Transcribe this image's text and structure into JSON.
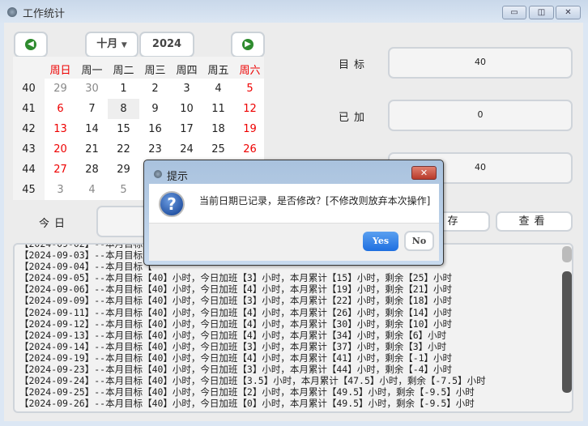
{
  "window": {
    "title": "工作统计",
    "minimize": "▭",
    "restore": "◫",
    "close": "✕"
  },
  "calendar": {
    "month": "十月",
    "year": "2024",
    "prev": "◀",
    "next": "▶",
    "weekdays": [
      "周日",
      "周一",
      "周二",
      "周三",
      "周四",
      "周五",
      "周六"
    ],
    "weeks": [
      "40",
      "41",
      "42",
      "43",
      "44",
      "45"
    ],
    "days": [
      [
        "29",
        "30",
        "1",
        "2",
        "3",
        "4",
        "5"
      ],
      [
        "6",
        "7",
        "8",
        "9",
        "10",
        "11",
        "12"
      ],
      [
        "13",
        "14",
        "15",
        "16",
        "17",
        "18",
        "19"
      ],
      [
        "20",
        "21",
        "22",
        "23",
        "24",
        "25",
        "26"
      ],
      [
        "27",
        "28",
        "29",
        "30",
        "31",
        "1",
        "2"
      ],
      [
        "3",
        "4",
        "5",
        "6",
        "7",
        "8",
        "9"
      ]
    ],
    "selected": "8"
  },
  "form": {
    "target_label": "目标",
    "target_value": "40",
    "added_label": "已加",
    "added_value": "0",
    "third_value": "40",
    "today_label": "今日",
    "save": "保存",
    "view": "查看"
  },
  "log": [
    "【2024-09-03】--本月目标【",
    "【2024-09-04】--本月目标【",
    "【2024-09-05】--本月目标【40】小时，今日加班【3】小时，本月累计【15】小时，剩余【25】小时",
    "【2024-09-06】--本月目标【40】小时，今日加班【4】小时，本月累计【19】小时，剩余【21】小时",
    "【2024-09-09】--本月目标【40】小时，今日加班【3】小时，本月累计【22】小时，剩余【18】小时",
    "【2024-09-11】--本月目标【40】小时，今日加班【4】小时，本月累计【26】小时，剩余【14】小时",
    "【2024-09-12】--本月目标【40】小时，今日加班【4】小时，本月累计【30】小时，剩余【10】小时",
    "【2024-09-13】--本月目标【40】小时，今日加班【4】小时，本月累计【34】小时，剩余【6】小时",
    "【2024-09-14】--本月目标【40】小时，今日加班【3】小时，本月累计【37】小时，剩余【3】小时",
    "【2024-09-19】--本月目标【40】小时，今日加班【4】小时，本月累计【41】小时，剩余【-1】小时",
    "【2024-09-23】--本月目标【40】小时，今日加班【3】小时，本月累计【44】小时，剩余【-4】小时",
    "【2024-09-24】--本月目标【40】小时，今日加班【3.5】小时，本月累计【47.5】小时，剩余【-7.5】小时",
    "【2024-09-25】--本月目标【40】小时，今日加班【2】小时，本月累计【49.5】小时，剩余【-9.5】小时",
    "【2024-09-26】--本月目标【40】小时，今日加班【0】小时，本月累计【49.5】小时，剩余【-9.5】小时"
  ],
  "dialog": {
    "title": "提示",
    "message": "当前日期已记录，是否修改？[不修改则放弃本次操作]",
    "yes": "Yes",
    "no": "No",
    "icon": "question-icon",
    "close": "✕"
  }
}
